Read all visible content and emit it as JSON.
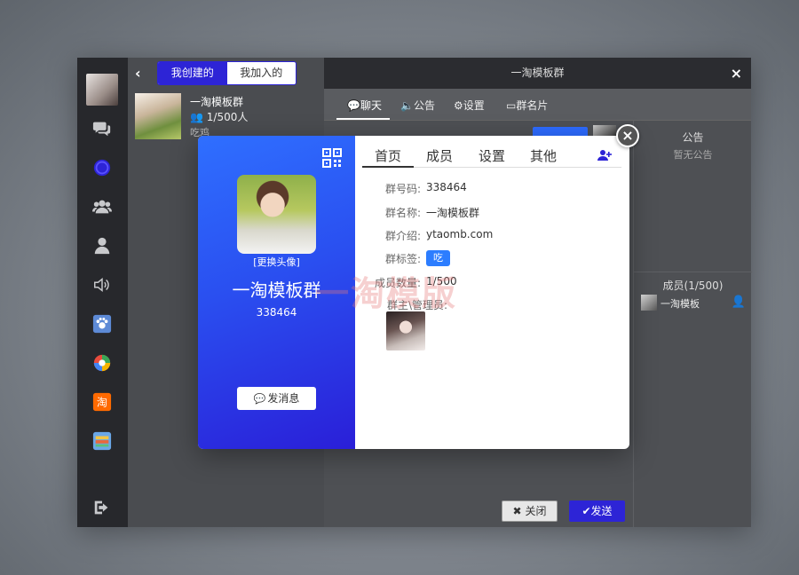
{
  "nav": {
    "items": [
      {
        "icon": "chat-bubbles-icon"
      },
      {
        "icon": "clock-icon"
      },
      {
        "icon": "group-icon"
      },
      {
        "icon": "user-icon"
      },
      {
        "icon": "speaker-icon"
      },
      {
        "icon": "paw-app-icon"
      },
      {
        "icon": "colorful-app-icon"
      },
      {
        "icon": "taobao-app-icon",
        "label": "淘"
      },
      {
        "icon": "folder-app-icon"
      },
      {
        "icon": "logout-icon"
      }
    ]
  },
  "list": {
    "seg_created": "我创建的",
    "seg_joined": "我加入的",
    "group_name": "一淘模板群",
    "group_count": "1/500人",
    "group_tag": "吃鸡"
  },
  "chat": {
    "title": "一淘模板群",
    "tabs": [
      "聊天",
      "公告",
      "设置",
      "群名片"
    ],
    "notice_title": "公告",
    "notice_empty": "暂无公告",
    "member_title": "成员(1/500)",
    "member_name": "一淘模板",
    "close_label": "关闭",
    "send_label": "发送"
  },
  "modal": {
    "change_avatar": "[更换头像]",
    "group_name": "一淘模板群",
    "group_id": "338464",
    "send_message": "发消息",
    "tabs": [
      "首页",
      "成员",
      "设置",
      "其他"
    ],
    "fields": {
      "id_label": "群号码:",
      "id_value": "338464",
      "name_label": "群名称:",
      "name_value": "一淘模板群",
      "intro_label": "群介绍:",
      "intro_value": "ytaomb.com",
      "tag_label": "群标签:",
      "tag_value": "吃鸡",
      "count_label": "成员数量:",
      "count_value": "1/500",
      "admins_label": "群主\\管理员:"
    },
    "watermark": "一淘模版"
  }
}
